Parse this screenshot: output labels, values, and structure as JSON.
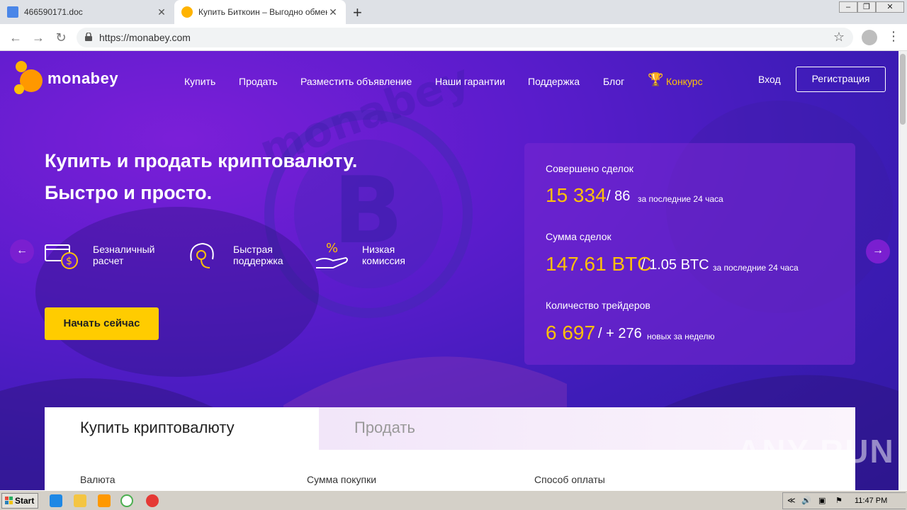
{
  "browser": {
    "tabs": [
      {
        "title": "466590171.doc",
        "active": false
      },
      {
        "title": "Купить Биткоин – Выгодно обмена",
        "active": true
      }
    ],
    "url": "https://monabey.com"
  },
  "site": {
    "logo_text": "monabey",
    "nav": {
      "buy": "Купить",
      "sell": "Продать",
      "post_ad": "Разместить объявление",
      "guarantees": "Наши гарантии",
      "support": "Поддержка",
      "blog": "Блог",
      "contest": "Конкурс"
    },
    "login": "Вход",
    "register": "Регистрация",
    "headline_line1": "Купить и продать криптовалюту.",
    "headline_line2": "Быстро и просто.",
    "features": [
      {
        "line1": "Безналичный",
        "line2": "расчет"
      },
      {
        "line1": "Быстрая",
        "line2": "поддержка"
      },
      {
        "line1": "Низкая",
        "line2": "комиссия"
      }
    ],
    "start_button": "Начать сейчас",
    "stats": {
      "deals_title": "Совершено сделок",
      "deals_total": "15 334",
      "deals_day": "/ 86",
      "deals_period": "за последние 24 часа",
      "sum_title": "Сумма сделок",
      "sum_total": "147.61 BTC",
      "sum_day": "/ 1.05 BTC",
      "sum_period": "за последние 24 часа",
      "traders_title": "Количество трейдеров",
      "traders_total": "6 697",
      "traders_week": "/ + 276",
      "traders_period": "новых за неделю"
    },
    "trade": {
      "tab_buy": "Купить криптовалюту",
      "tab_sell": "Продать",
      "currency_label": "Валюта",
      "amount_label": "Сумма покупки",
      "payment_label": "Способ оплаты"
    }
  },
  "watermark": "ANY RUN",
  "taskbar": {
    "start": "Start",
    "clock": "11:47 PM"
  },
  "colors": {
    "accent": "#ffc107",
    "button_yellow": "#ffcc00",
    "purple": "#5a1ccc"
  }
}
